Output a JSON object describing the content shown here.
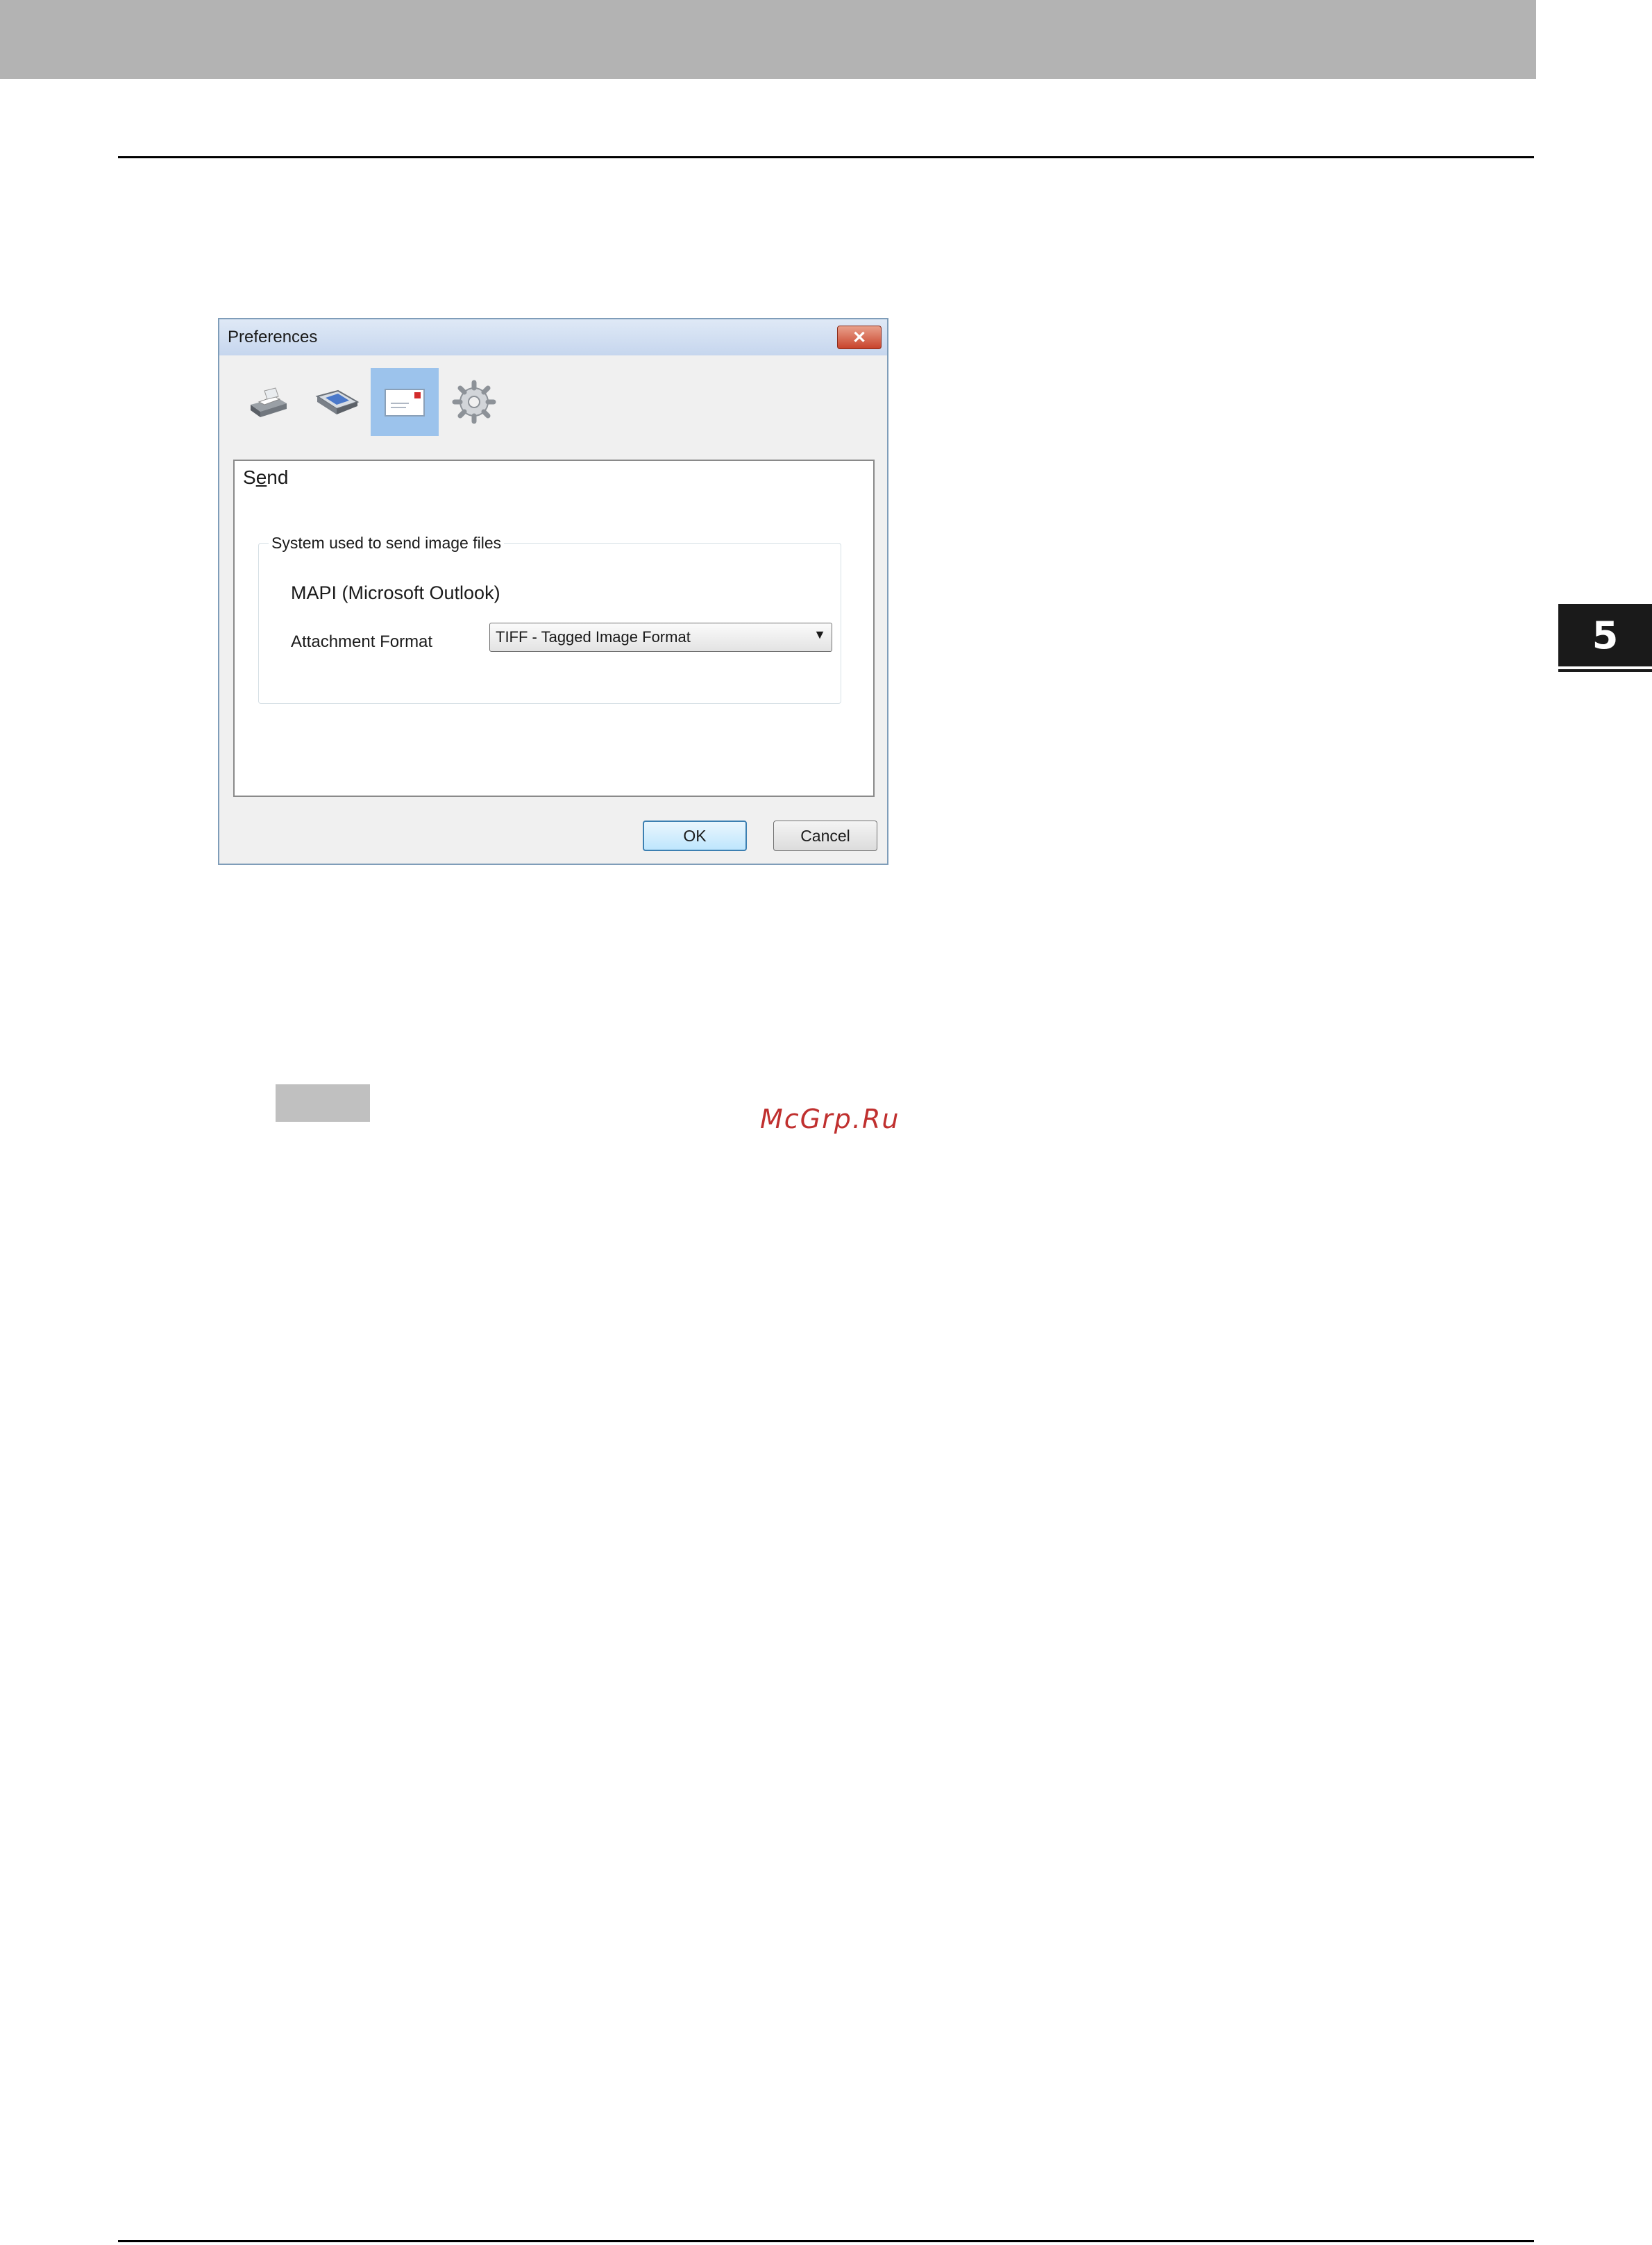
{
  "chapter_tab": {
    "number": "5"
  },
  "dialog": {
    "title": "Preferences",
    "close_glyph": "✕",
    "toolbar": [
      {
        "icon": "printer-icon",
        "selected": false
      },
      {
        "icon": "scanner-icon",
        "selected": false
      },
      {
        "icon": "envelope-icon",
        "selected": true
      },
      {
        "icon": "gear-icon",
        "selected": false
      }
    ],
    "panel": {
      "title_pre": "S",
      "title_mnemonic": "e",
      "title_post": "nd",
      "group": {
        "legend": "System used to send image files",
        "system_value": "MAPI (Microsoft Outlook)",
        "attachment_label": "Attachment Format",
        "attachment_value": "TIFF - Tagged Image Format",
        "dropdown_arrow": "▼"
      }
    },
    "ok_label": "OK",
    "cancel_label": "Cancel"
  },
  "watermark": "McGrp.Ru"
}
